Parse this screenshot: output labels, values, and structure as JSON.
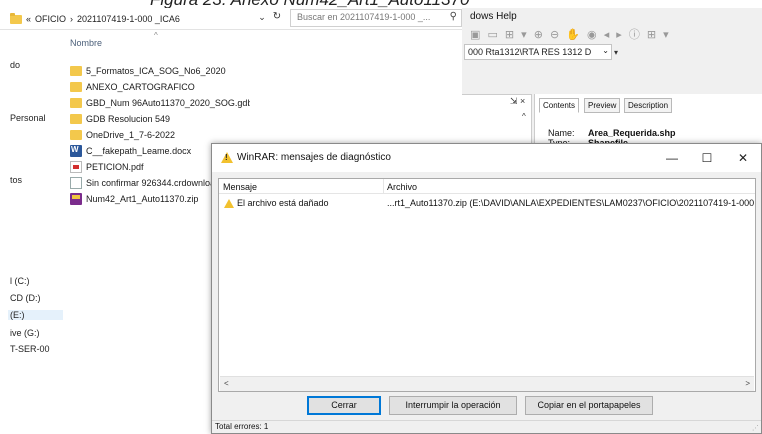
{
  "caption": "Figura 23. Anexo Num42_Art1_Auto11370",
  "explorer": {
    "breadcrumb_prefix": "«",
    "breadcrumb_1": "OFICIO",
    "breadcrumb_sep": "›",
    "breadcrumb_2": "2021107419-1-000 _ICA6",
    "dropdown_glyph": "⌄",
    "refresh_glyph": "↻",
    "search_placeholder": "Buscar en 2021107419-1-000 _...",
    "search_glyph": "⚲",
    "column_name": "Nombre",
    "sort_glyph": "^",
    "nav_items": [
      "do",
      "Personal",
      "tos",
      "l (C:)",
      "CD (D:)",
      "(E:)",
      "ive (G:)",
      "T-SER-00"
    ],
    "files": [
      {
        "name": "5_Formatos_ICA_SOG_No6_2020",
        "type": "folder"
      },
      {
        "name": "ANEXO_CARTOGRAFICO",
        "type": "folder"
      },
      {
        "name": "GBD_Num 96Auto11370_2020_SOG.gdb",
        "type": "folder"
      },
      {
        "name": "GDB Resolucion 549",
        "type": "folder"
      },
      {
        "name": "OneDrive_1_7-6-2022",
        "type": "folder"
      },
      {
        "name": "C__fakepath_Leame.docx",
        "type": "word"
      },
      {
        "name": "PETICION.pdf",
        "type": "pdf"
      },
      {
        "name": "Sin confirmar 926344.crdownload",
        "type": "doc"
      },
      {
        "name": "Num42_Art1_Auto11370.zip",
        "type": "zip"
      }
    ]
  },
  "arcmap": {
    "menu": "dows   Help",
    "toolbar_glyphs": "▣ ▭ ⊞ ▾ ⊕ ⊖ ✋ ◉ ◂ ▸ ⓘ ⊞ ▾",
    "layer_combo": "000 Rta1312\\RTA RES 1312 D",
    "combo_glyph": "⌄",
    "small_dd_glyph": "▾",
    "pane_ctrl": "⇲ ×",
    "scroll_up": "^",
    "tabs": [
      "Contents",
      "Preview",
      "Description"
    ],
    "prop_name_label": "Name:",
    "prop_name_value": "Area_Requerida.shp",
    "prop_type_label": "Type:",
    "prop_type_value": "Shapefile"
  },
  "dialog": {
    "title": "WinRAR: mensajes de diagnóstico",
    "win_min": "—",
    "win_max": "☐",
    "win_close": "✕",
    "col_message": "Mensaje",
    "col_file": "Archivo",
    "rows": [
      {
        "message": "El archivo está dañado",
        "file": "...rt1_Auto11370.zip (E:\\DAVID\\ANLA\\EXPEDIENTES\\LAM0237\\OFICIO\\2021107419-1-000 _I"
      }
    ],
    "scroll_left": "<",
    "scroll_right": ">",
    "btn_close": "Cerrar",
    "btn_interrupt": "Interrumpir la operación",
    "btn_copy": "Copiar en el portapapeles",
    "status": "Total errores: 1",
    "grip": "⋰"
  }
}
